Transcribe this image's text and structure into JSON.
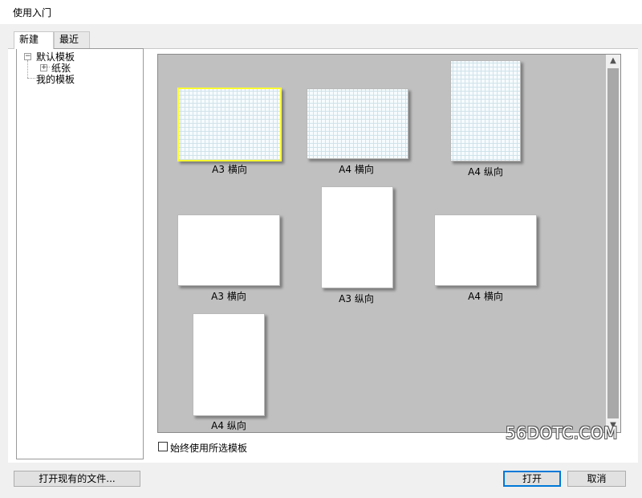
{
  "window": {
    "title": "使用入门"
  },
  "tabs": [
    {
      "label": "新建",
      "active": true
    },
    {
      "label": "最近",
      "active": false
    }
  ],
  "tree": {
    "default_templates": "默认模板",
    "paper": "纸张",
    "my_templates": "我的模板",
    "collapse_symbol": "−",
    "expand_symbol": "+"
  },
  "templates": [
    {
      "caption": "A3  横向",
      "grid": true,
      "selected": true
    },
    {
      "caption": "A4  横向",
      "grid": true,
      "selected": false
    },
    {
      "caption": "A4  纵向",
      "grid": true,
      "selected": false
    },
    {
      "caption": "A3  横向",
      "grid": false,
      "selected": false
    },
    {
      "caption": "A3  纵向",
      "grid": false,
      "selected": false
    },
    {
      "caption": "A4  横向",
      "grid": false,
      "selected": false
    },
    {
      "caption": "A4  纵向",
      "grid": false,
      "selected": false
    }
  ],
  "scrollbar": {
    "up_arrow": "▲",
    "down_arrow": "▼"
  },
  "options": {
    "always_use_selected": "始终使用所选模板",
    "checked": false
  },
  "watermark": "56DOTC.COM",
  "buttons": {
    "open_existing": "打开现有的文件...",
    "open": "打开",
    "cancel": "取消"
  },
  "colors": {
    "selection_border": "#ffff30",
    "preview_background": "#c0c0c0",
    "default_button_border": "#0078d7"
  }
}
